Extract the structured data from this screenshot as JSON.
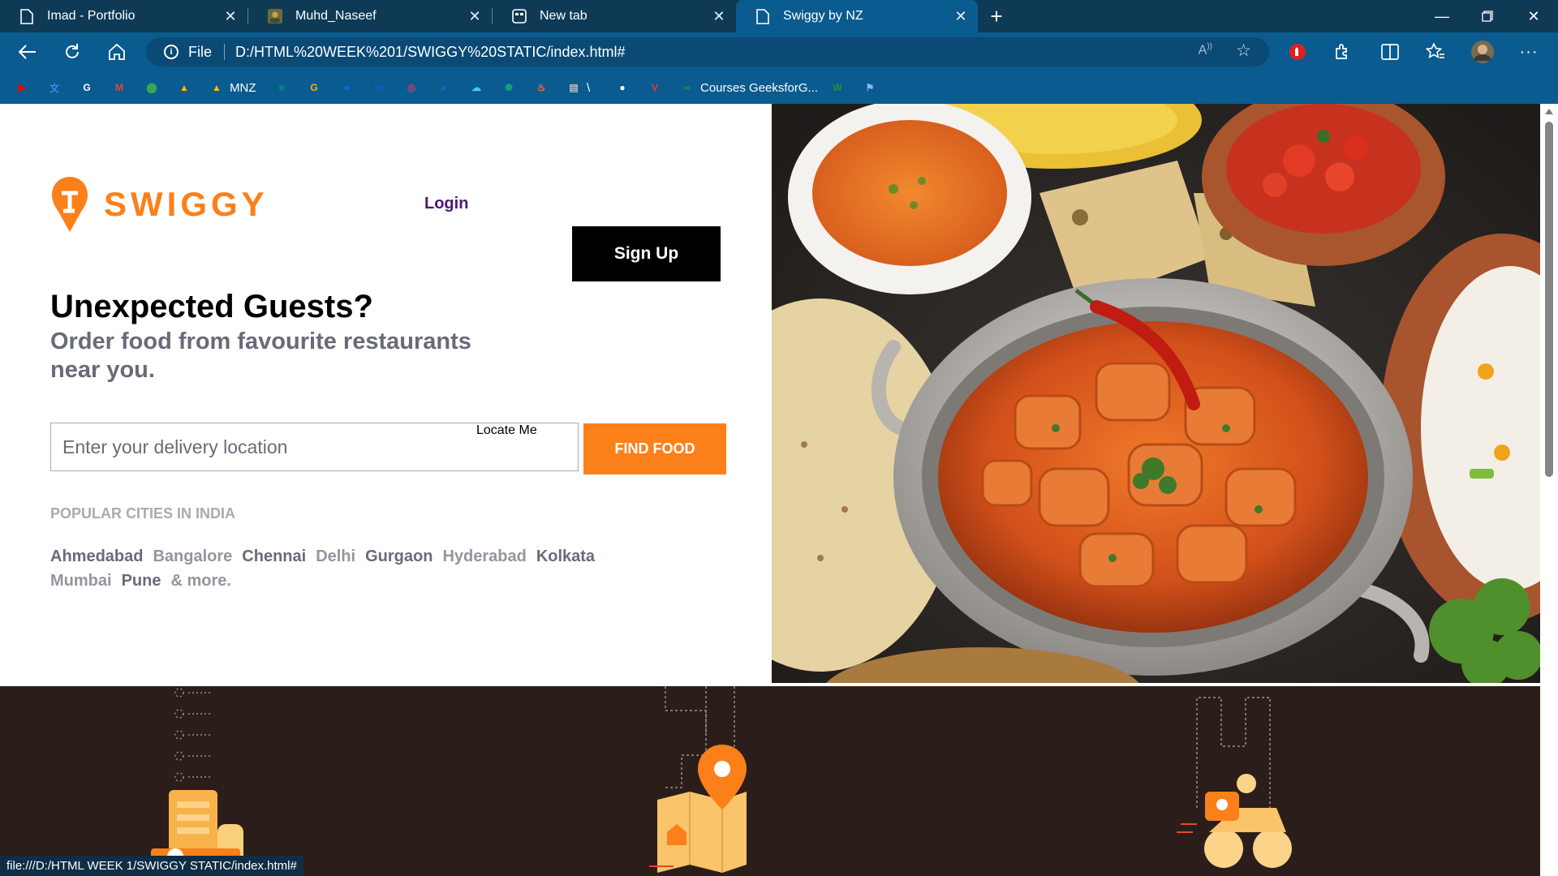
{
  "browser": {
    "tabs": [
      {
        "title": "Imad - Portfolio",
        "icon": "page-icon"
      },
      {
        "title": "Muhd_Naseef",
        "icon": "avatar-icon"
      },
      {
        "title": "New tab",
        "icon": "new-tab-icon"
      },
      {
        "title": "Swiggy by NZ",
        "icon": "page-icon",
        "active": true
      }
    ],
    "address": {
      "scheme": "File",
      "url": "D:/HTML%20WEEK%201/SWIGGY%20STATIC/index.html#"
    },
    "bookmarks": [
      {
        "label": "",
        "icon": "youtube-icon",
        "color": "#ff0000"
      },
      {
        "label": "",
        "icon": "translate-icon",
        "color": "#4285f4"
      },
      {
        "label": "",
        "icon": "google-icon",
        "color": "#ffffff"
      },
      {
        "label": "",
        "icon": "gmail-icon",
        "color": "#ea4335"
      },
      {
        "label": "",
        "icon": "maps-icon",
        "color": "#34a853"
      },
      {
        "label": "",
        "icon": "drive-icon",
        "color": "#fbbc04"
      },
      {
        "label": "MNZ",
        "icon": "drive-icon",
        "color": "#fbbc04"
      },
      {
        "label": "",
        "icon": "meet-icon",
        "color": "#00897b"
      },
      {
        "label": "",
        "icon": "g-icon",
        "color": "#f4b400"
      },
      {
        "label": "",
        "icon": "meta-icon",
        "color": "#0081fb"
      },
      {
        "label": "",
        "icon": "linkedin-icon",
        "color": "#0a66c2"
      },
      {
        "label": "",
        "icon": "instagram-icon",
        "color": "#e1306c"
      },
      {
        "label": "",
        "icon": "search-app-icon",
        "color": "#1a73e8"
      },
      {
        "label": "",
        "icon": "cloud-icon",
        "color": "#4fc3f7"
      },
      {
        "label": "",
        "icon": "chatgpt-icon",
        "color": "#10a37f"
      },
      {
        "label": "",
        "icon": "fire-icon",
        "color": "#ff7043"
      },
      {
        "label": "\\",
        "icon": "notes-icon",
        "color": "#bdbdbd"
      },
      {
        "label": "",
        "icon": "github-icon",
        "color": "#ffffff"
      },
      {
        "label": "",
        "icon": "vidyard-icon",
        "color": "#e53935"
      },
      {
        "label": "Courses GeeksforG...",
        "icon": "gfg-icon",
        "color": "#2f8d46"
      },
      {
        "label": "",
        "icon": "w-icon",
        "color": "#2f8d46"
      },
      {
        "label": "",
        "icon": "flag-icon",
        "color": "#8ab4f8"
      }
    ],
    "status_url": "file:///D:/HTML WEEK 1/SWIGGY STATIC/index.html#"
  },
  "page": {
    "brand": "SWIGGY",
    "login": "Login",
    "signup": "Sign Up",
    "headline": "Unexpected Guests?",
    "subheadline": "Order food from favourite restaurants near you.",
    "location": {
      "placeholder": "Enter your delivery location",
      "locate_me": "Locate Me",
      "find_food": "FIND FOOD"
    },
    "popular_title": "POPULAR CITIES IN INDIA",
    "cities": [
      "Ahmedabad",
      "Bangalore",
      "Chennai",
      "Delhi",
      "Gurgaon",
      "Hyderabad",
      "Kolkata",
      "Mumbai",
      "Pune",
      "& more."
    ],
    "colors": {
      "brand_orange": "#fc8019",
      "login_purple": "#4a1777",
      "band_brown": "#2b1e1a"
    }
  }
}
